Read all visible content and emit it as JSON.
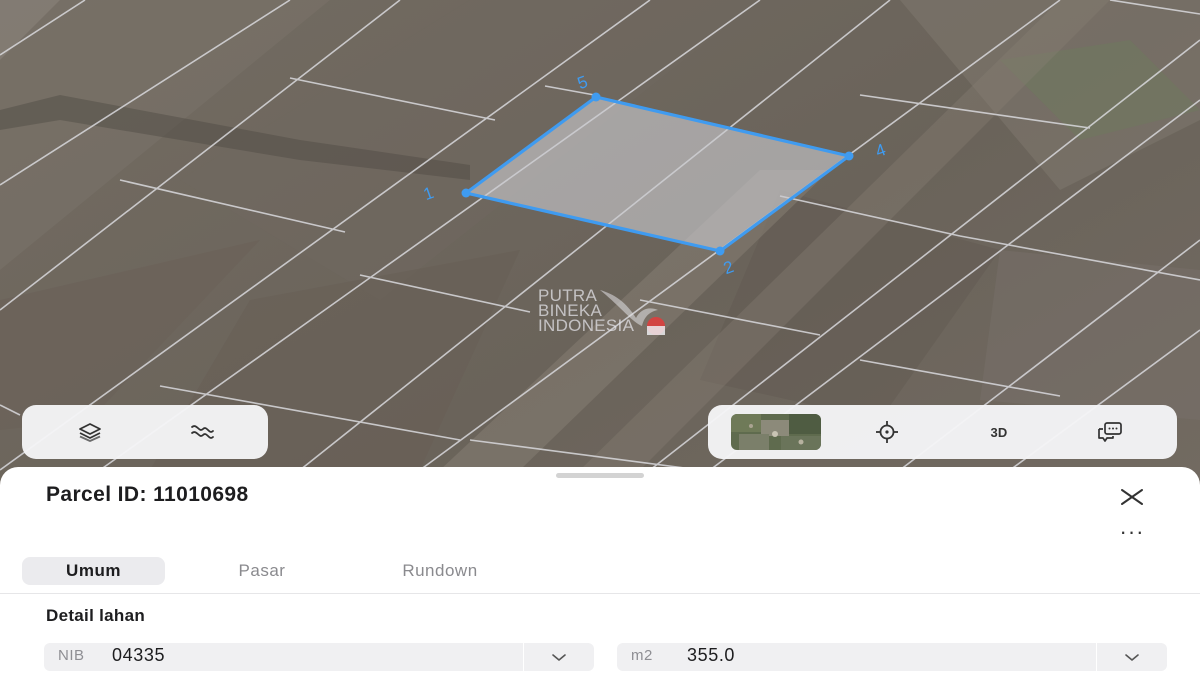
{
  "map": {
    "watermark_lines": [
      "PUTRA",
      "BINEKA",
      "INDONESIA"
    ],
    "parcel_vertices": [
      {
        "label": "1"
      },
      {
        "label": "2"
      },
      {
        "label": "4"
      },
      {
        "label": "5"
      }
    ],
    "colors": {
      "parcel_outline": "#3f9bf0",
      "parcel_fill": "#c9c9ce"
    }
  },
  "map_controls": {
    "left": [
      {
        "icon": "layers-icon"
      },
      {
        "icon": "route-icon"
      }
    ],
    "right": [
      {
        "icon": "basemap-thumbnail"
      },
      {
        "icon": "crosshair-icon"
      },
      {
        "icon": "3d-label",
        "label": "3D"
      },
      {
        "icon": "chat-icon"
      }
    ]
  },
  "panel": {
    "title": "Parcel ID: 11010698",
    "close_icon": "close-icon",
    "more_label": "···",
    "tabs": [
      {
        "label": "Umum",
        "active": true
      },
      {
        "label": "Pasar",
        "active": false
      },
      {
        "label": "Rundown",
        "active": false
      }
    ],
    "section_title": "Detail lahan",
    "fields": [
      {
        "prefix": "NIB",
        "value": "04335"
      },
      {
        "prefix": "m2",
        "value": "355.0"
      }
    ]
  }
}
